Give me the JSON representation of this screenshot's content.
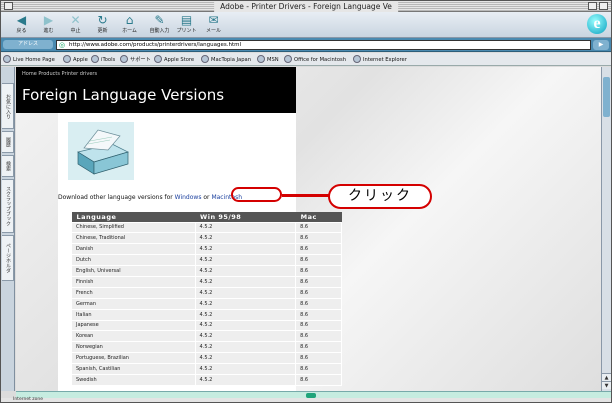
{
  "window": {
    "title": "Adobe - Printer Drivers - Foreign Language Ve"
  },
  "toolbar": {
    "buttons": [
      {
        "label": "戻る",
        "icon": "back-icon"
      },
      {
        "label": "進む",
        "icon": "forward-icon"
      },
      {
        "label": "中止",
        "icon": "stop-icon"
      },
      {
        "label": "更新",
        "icon": "refresh-icon"
      },
      {
        "label": "ホーム",
        "icon": "home-icon"
      },
      {
        "label": "自動入力",
        "icon": "autofill-icon"
      },
      {
        "label": "プリント",
        "icon": "print-icon"
      },
      {
        "label": "メール",
        "icon": "mail-icon"
      }
    ]
  },
  "address": {
    "label": "アドレス",
    "url": "http://www.adobe.com/products/printerdrivers/languages.html",
    "go_label": "移動"
  },
  "favorites": [
    "Live Home Page",
    "Apple",
    "iTools",
    "サポート",
    "Apple Store",
    "MacTopia Japan",
    "MSN",
    "Office for Macintosh",
    "Internet Explorer"
  ],
  "explorer_tabs": [
    "お気に入り",
    "履歴",
    "検索",
    "スクラップブック",
    "ページホルダ"
  ],
  "page": {
    "breadcrumb": "Home  Products  Printer drivers",
    "heading": "Foreign Language Versions",
    "download_prefix": "Download other language versions for",
    "link_windows": "Windows",
    "link_or": "or",
    "link_mac": "Macintosh",
    "callout": "クリック"
  },
  "table": {
    "headers": [
      "Language",
      "Win 95/98",
      "Mac"
    ],
    "rows": [
      [
        "Chinese, Simplified",
        "4.5.2",
        "8.6"
      ],
      [
        "Chinese, Traditional",
        "4.5.2",
        "8.6"
      ],
      [
        "Danish",
        "4.5.2",
        "8.6"
      ],
      [
        "Dutch",
        "4.5.2",
        "8.6"
      ],
      [
        "English, Universal",
        "4.5.2",
        "8.6"
      ],
      [
        "Finnish",
        "4.5.2",
        "8.6"
      ],
      [
        "French",
        "4.5.2",
        "8.6"
      ],
      [
        "German",
        "4.5.2",
        "8.6"
      ],
      [
        "Italian",
        "4.5.2",
        "8.6"
      ],
      [
        "Japanese",
        "4.5.2",
        "8.6"
      ],
      [
        "Korean",
        "4.5.2",
        "8.6"
      ],
      [
        "Norwegian",
        "4.5.2",
        "8.6"
      ],
      [
        "Portuguese, Brazilian",
        "4.5.2",
        "8.6"
      ],
      [
        "Spanish, Castilian",
        "4.5.2",
        "8.6"
      ],
      [
        "Swedish",
        "4.5.2",
        "8.6"
      ]
    ]
  },
  "status": {
    "text": "Internet zone"
  },
  "colors": {
    "callout": "#d40000",
    "header_bg": "#000000",
    "accent": "#4a8ab0"
  }
}
